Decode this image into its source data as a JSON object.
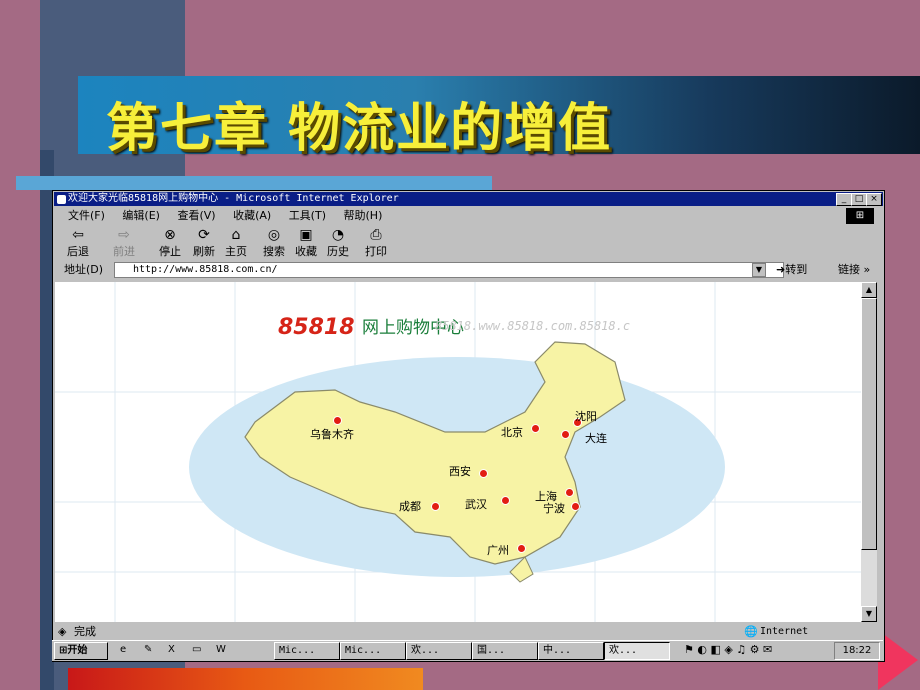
{
  "slide": {
    "title": "第七章  物流业的增值"
  },
  "window": {
    "title": "欢迎大家光临85818网上购物中心 - Microsoft Internet Explorer",
    "controls": [
      "_",
      "□",
      "×"
    ]
  },
  "menu": [
    "文件(F)",
    "编辑(E)",
    "查看(V)",
    "收藏(A)",
    "工具(T)",
    "帮助(H)"
  ],
  "toolbar": [
    {
      "label": "后退",
      "icon": "⇦"
    },
    {
      "label": "前进",
      "icon": "⇨"
    },
    {
      "label": "停止",
      "icon": "⊗"
    },
    {
      "label": "刷新",
      "icon": "⟳"
    },
    {
      "label": "主页",
      "icon": "⌂"
    },
    {
      "label": "搜索",
      "icon": "◎"
    },
    {
      "label": "收藏",
      "icon": "▣"
    },
    {
      "label": "历史",
      "icon": "◔"
    },
    {
      "label": "打印",
      "icon": "⎙"
    }
  ],
  "address": {
    "label": "地址(D)",
    "url": "http://www.85818.com.cn/",
    "go": "转到",
    "links": "链接 »"
  },
  "site": {
    "logo": "85818",
    "name": "网上购物中心",
    "banner_text": "85818.www.85818.com.85818.c"
  },
  "cities": [
    "乌鲁木齐",
    "北京",
    "沈阳",
    "大连",
    "西安",
    "成都",
    "武汉",
    "上海",
    "宁波",
    "广州"
  ],
  "statusbar": {
    "left": "完成",
    "zone": "Internet"
  },
  "taskbar": {
    "start": "开始",
    "tasks": [
      "Mic...",
      "Mic...",
      "欢...",
      "国...",
      "中...",
      "欢..."
    ],
    "clock": "18:22"
  }
}
